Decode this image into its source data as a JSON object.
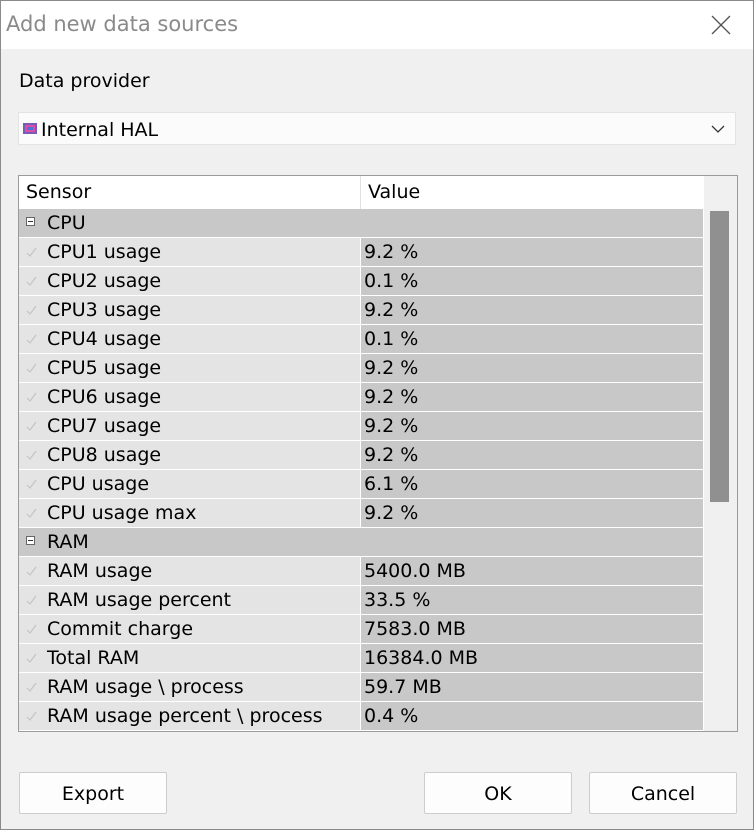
{
  "window": {
    "title": "Add new data sources"
  },
  "provider": {
    "label": "Data provider",
    "selected": "Internal HAL",
    "icon": "hal-chip-icon"
  },
  "grid": {
    "columns": {
      "sensor": "Sensor",
      "value": "Value"
    },
    "rows": [
      {
        "type": "group",
        "name": "CPU"
      },
      {
        "type": "item",
        "name": "CPU1 usage",
        "value": "9.2 %"
      },
      {
        "type": "item",
        "name": "CPU2 usage",
        "value": "0.1 %"
      },
      {
        "type": "item",
        "name": "CPU3 usage",
        "value": "9.2 %"
      },
      {
        "type": "item",
        "name": "CPU4 usage",
        "value": "0.1 %"
      },
      {
        "type": "item",
        "name": "CPU5 usage",
        "value": "9.2 %"
      },
      {
        "type": "item",
        "name": "CPU6 usage",
        "value": "9.2 %"
      },
      {
        "type": "item",
        "name": "CPU7 usage",
        "value": "9.2 %"
      },
      {
        "type": "item",
        "name": "CPU8 usage",
        "value": "9.2 %"
      },
      {
        "type": "item",
        "name": "CPU usage",
        "value": "6.1 %"
      },
      {
        "type": "item",
        "name": "CPU usage max",
        "value": "9.2 %"
      },
      {
        "type": "group",
        "name": "RAM"
      },
      {
        "type": "item",
        "name": "RAM usage",
        "value": "5400.0 MB"
      },
      {
        "type": "item",
        "name": "RAM usage percent",
        "value": "33.5 %"
      },
      {
        "type": "item",
        "name": "Commit charge",
        "value": "7583.0 MB"
      },
      {
        "type": "item",
        "name": "Total RAM",
        "value": "16384.0 MB"
      },
      {
        "type": "item",
        "name": "RAM usage \\ process",
        "value": "59.7 MB"
      },
      {
        "type": "item",
        "name": "RAM usage percent \\ process",
        "value": "0.4 %"
      }
    ]
  },
  "buttons": {
    "export": "Export",
    "ok": "OK",
    "cancel": "Cancel"
  },
  "colors": {
    "group_bg": "#c8c8c8",
    "name_bg": "#e4e4e4",
    "value_bg": "#c8c8c8"
  }
}
